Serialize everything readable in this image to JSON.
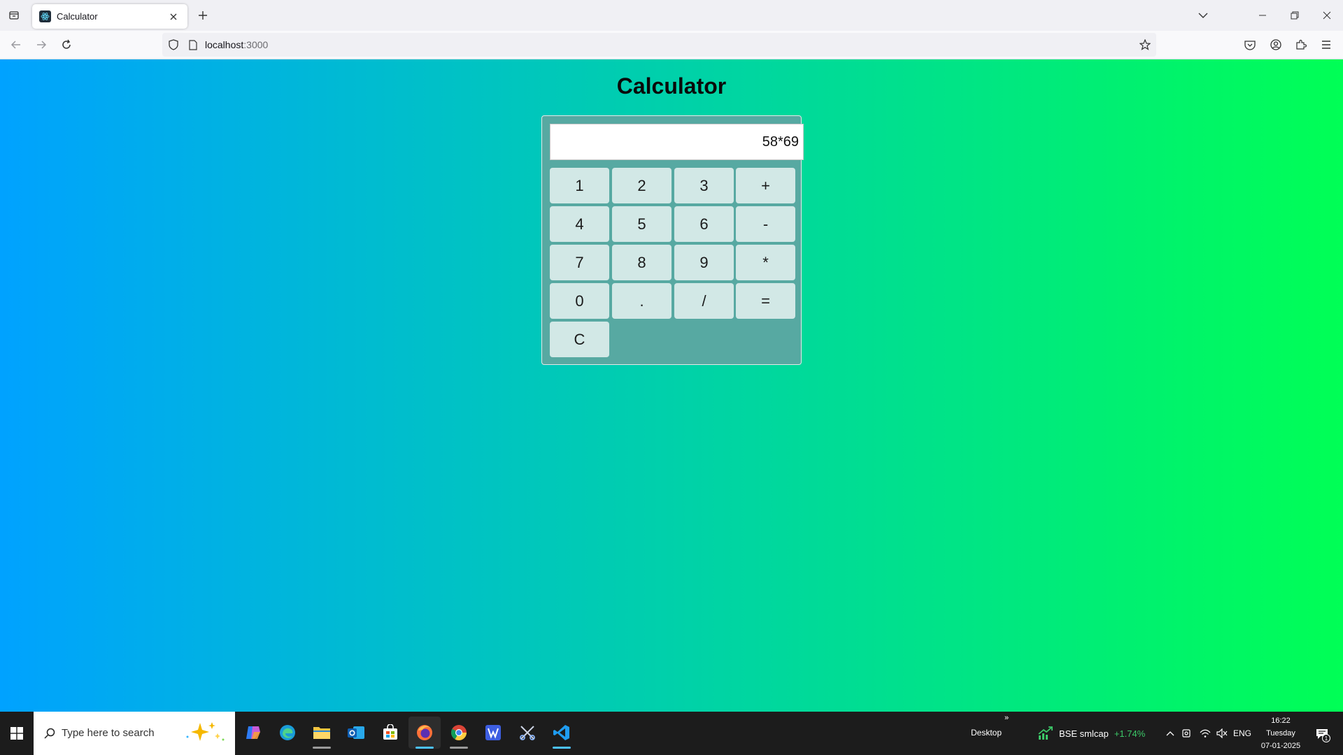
{
  "browser": {
    "tab": {
      "title": "Calculator"
    },
    "url": {
      "host": "localhost",
      "port": ":3000"
    }
  },
  "page": {
    "title": "Calculator",
    "display_value": "58*69",
    "keys": [
      "1",
      "2",
      "3",
      "+",
      "4",
      "5",
      "6",
      "-",
      "7",
      "8",
      "9",
      "*",
      "0",
      ".",
      "/",
      "=",
      "C"
    ],
    "gradient": {
      "from": "#00a2ff",
      "to": "#00ff55"
    }
  },
  "taskbar": {
    "search_placeholder": "Type here to search",
    "desktop_label": "Desktop",
    "overflow": "»",
    "stock": {
      "label": "BSE smlcap",
      "change": "+1.74%"
    },
    "language": "ENG",
    "clock": {
      "time": "16:22",
      "day": "Tuesday",
      "date": "07-01-2025"
    },
    "notification_count": "1"
  }
}
